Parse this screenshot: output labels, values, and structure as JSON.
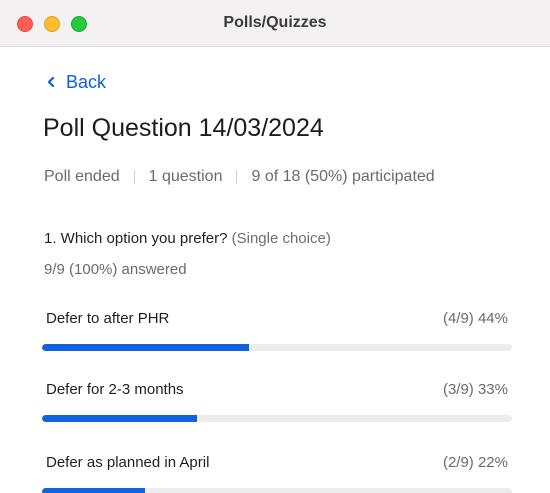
{
  "window": {
    "title": "Polls/Quizzes"
  },
  "nav": {
    "back_label": "Back"
  },
  "poll": {
    "title": "Poll Question 14/03/2024",
    "status": "Poll ended",
    "question_count": "1 question",
    "participation": "9 of 18 (50%) participated"
  },
  "question": {
    "text": "1. Which option you prefer?",
    "type": "(Single choice)",
    "answered": "9/9 (100%) answered",
    "options": [
      {
        "label": "Defer to after PHR",
        "stat": "(4/9) 44%",
        "percent": 44
      },
      {
        "label": "Defer for 2-3 months",
        "stat": "(3/9) 33%",
        "percent": 33
      },
      {
        "label": "Defer as planned in April",
        "stat": "(2/9) 22%",
        "percent": 22
      }
    ]
  },
  "colors": {
    "accent": "#0e63e0",
    "link": "#0e5fd8",
    "track": "#ececec"
  }
}
